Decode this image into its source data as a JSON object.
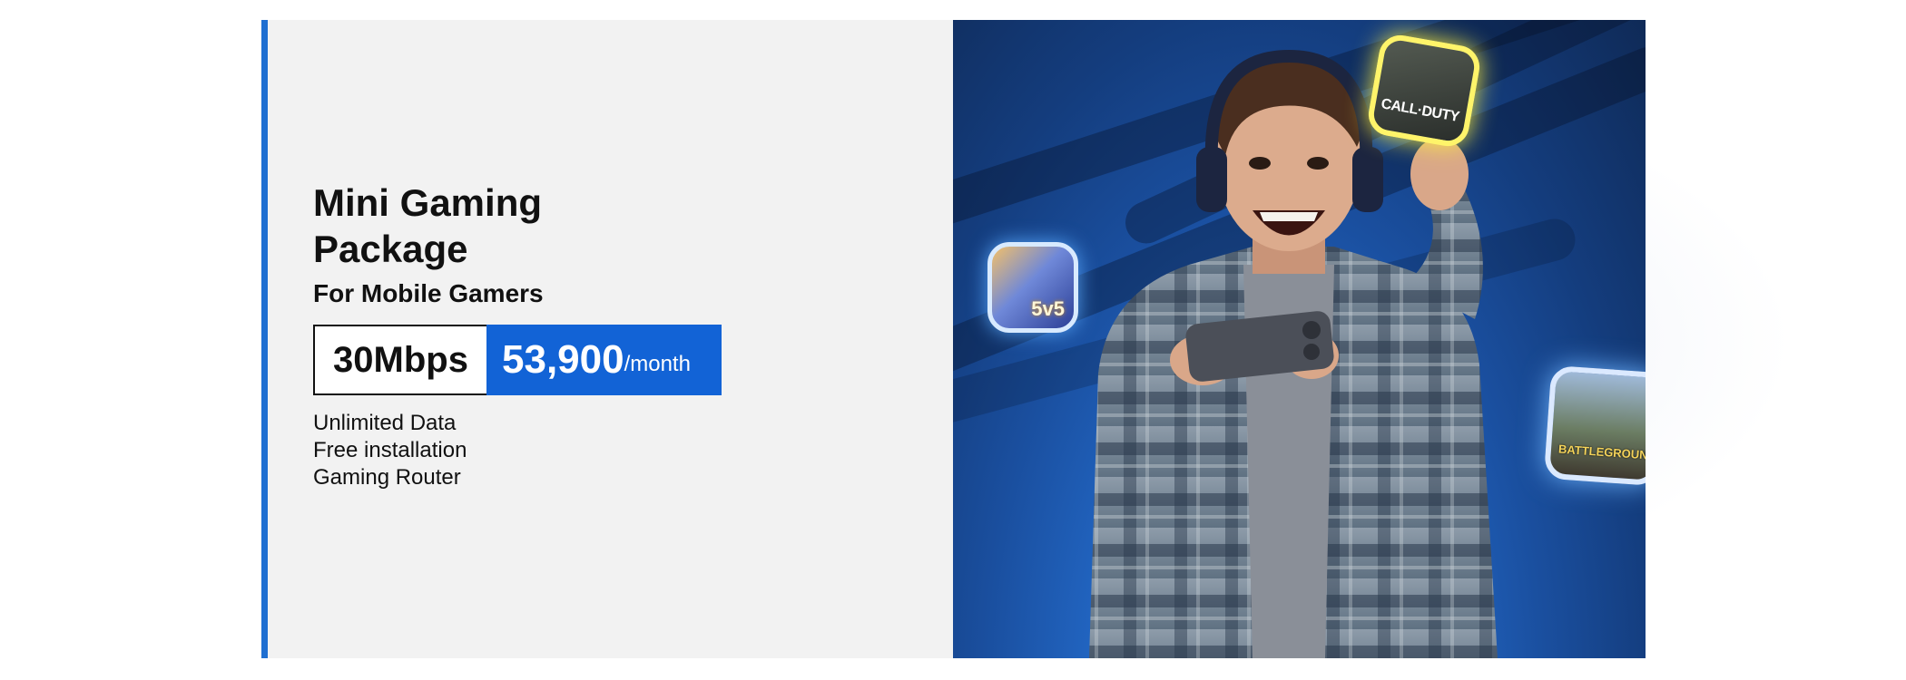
{
  "package": {
    "title": "Mini Gaming Package",
    "subtitle": "For Mobile Gamers",
    "speed": "30Mbps",
    "price": "53,900",
    "price_unit": "/month",
    "features": [
      "Unlimited Data",
      "Free installation",
      "Gaming Router"
    ]
  },
  "games": {
    "mobile_legends_badge": "5v5",
    "call_of_duty_logo": "CALL·DUTY",
    "pubg_logo": "BATTLEGROUNDS"
  },
  "colors": {
    "accent": "#1f6fd1",
    "price_bg": "#1263d6",
    "panel_bg": "#f2f2f2",
    "hero_bg": "#1a4f9f"
  }
}
